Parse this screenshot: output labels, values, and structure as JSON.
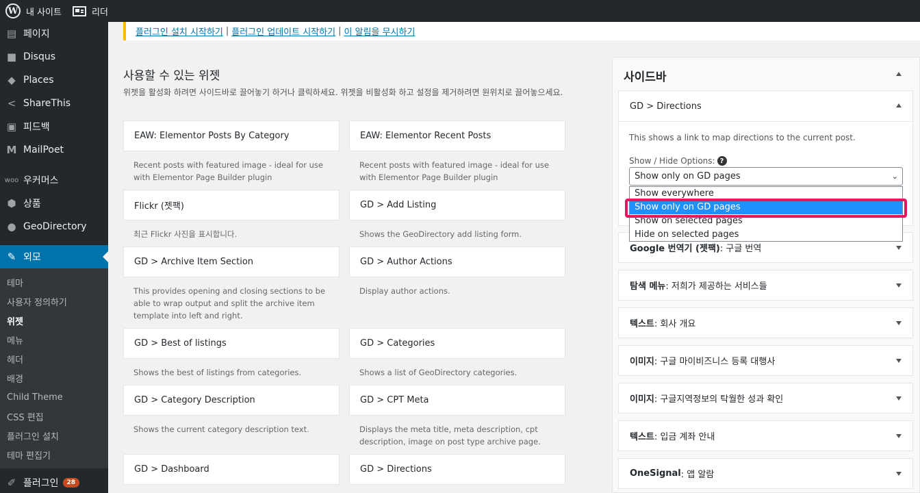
{
  "adminbar": {
    "site_label": "내 사이트",
    "reader_label": "리더"
  },
  "sidebar": {
    "items": [
      {
        "label": "페이지",
        "icon": "pages-icon"
      },
      {
        "label": "Disqus",
        "icon": "comment-icon"
      },
      {
        "label": "Places",
        "icon": "places-icon"
      },
      {
        "label": "ShareThis",
        "icon": "share-icon"
      },
      {
        "label": "피드백",
        "icon": "feedback-icon"
      },
      {
        "label": "MailPoet",
        "icon": "mailpoet-icon"
      },
      {
        "label": "우커머스",
        "icon": "woocommerce-icon"
      },
      {
        "label": "상품",
        "icon": "product-icon"
      },
      {
        "label": "GeoDirectory",
        "icon": "globe-icon"
      }
    ],
    "current": {
      "label": "외모",
      "icon": "appearance-icon"
    },
    "submenu": [
      "테마",
      "사용자 정의하기",
      "위젯",
      "메뉴",
      "헤더",
      "배경",
      "Child Theme",
      "CSS 편집",
      "플러그인 설치",
      "테마 편집기"
    ],
    "plugins": {
      "label": "플러그인",
      "badge": "28"
    }
  },
  "notice": {
    "link1": "플러그인 설치 시작하기",
    "link2": "플러그인 업데이트 시작하기",
    "link3": "이 알림을 무시하기",
    "sep": "|"
  },
  "available": {
    "title": "사용할 수 있는 위젯",
    "description": "위젯을 활성화 하려면 사이드바로 끌어놓기 하거나 클릭하세요. 위젯을 비활성화 하고 설정을 제거하려면 원위치로 끌어놓으세요.",
    "widgets": [
      {
        "title": "EAW: Elementor Posts By Category",
        "desc": "Recent posts with featured image - ideal for use with Elementor Page Builder plugin"
      },
      {
        "title": "EAW: Elementor Recent Posts",
        "desc": "Recent posts with featured image - ideal for use with Elementor Page Builder plugin"
      },
      {
        "title": "Flickr (젯팩)",
        "desc": "최근 Flickr 사진을 표시합니다."
      },
      {
        "title": "GD > Add Listing",
        "desc": "Shows the GeoDirectory add listing form."
      },
      {
        "title": "GD > Archive Item Section",
        "desc": "This provides opening and closing sections to be able to wrap output and split the archive item template into left and right."
      },
      {
        "title": "GD > Author Actions",
        "desc": "Display author actions."
      },
      {
        "title": "GD > Best of listings",
        "desc": "Shows the best of listings from categories."
      },
      {
        "title": "GD > Categories",
        "desc": "Shows a list of GeoDirectory categories."
      },
      {
        "title": "GD > Category Description",
        "desc": "Shows the current category description text."
      },
      {
        "title": "GD > CPT Meta",
        "desc": "Displays the meta title, meta description, cpt description, image on post type archive page."
      },
      {
        "title": "GD > Dashboard",
        "desc": ""
      },
      {
        "title": "GD > Directions",
        "desc": ""
      }
    ]
  },
  "sidebar_area": {
    "title": "사이드바",
    "directions": {
      "title": "GD > Directions",
      "description": "This shows a link to map directions to the current post.",
      "options_label": "Show / Hide Options:",
      "help": "?",
      "selected": "Show only on GD pages",
      "chevron": "⌄",
      "options": [
        "Show everywhere",
        "Show only on GD pages",
        "Show on selected pages",
        "Hide on selected pages"
      ]
    },
    "widgets": [
      {
        "name": "Google 번역기 (젯팩)",
        "sub": ": 구글 번역"
      },
      {
        "name": "탐색 메뉴",
        "sub": ": 저희가 제공하는 서비스들"
      },
      {
        "name": "텍스트",
        "sub": ": 회사 개요"
      },
      {
        "name": "이미지",
        "sub": ": 구글 마이비즈니스 등록 대행사"
      },
      {
        "name": "이미지",
        "sub": ": 구글지역정보의 탁월한 성과 확인"
      },
      {
        "name": "텍스트",
        "sub": ": 입금 계좌 안내"
      },
      {
        "name": "OneSignal",
        "sub": ": 앱 알람"
      }
    ]
  }
}
